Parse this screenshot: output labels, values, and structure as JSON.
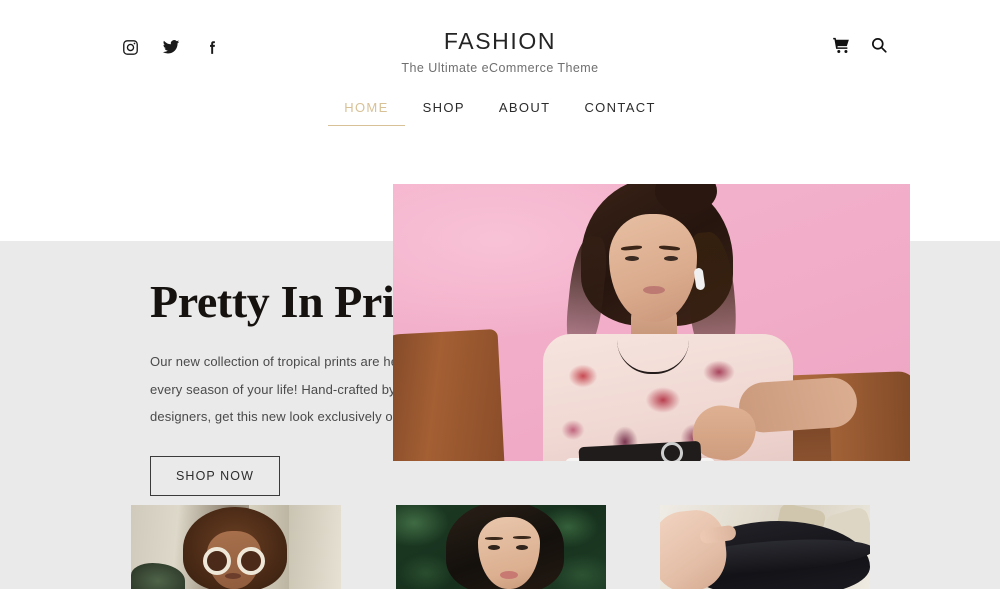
{
  "header": {
    "brand_title": "FASHION",
    "brand_tagline": "The Ultimate eCommerce Theme",
    "social": [
      {
        "name": "instagram-icon",
        "label": "Instagram"
      },
      {
        "name": "twitter-icon",
        "label": "Twitter"
      },
      {
        "name": "facebook-icon",
        "label": "Facebook"
      }
    ],
    "actions": [
      {
        "name": "cart-icon",
        "label": "Cart"
      },
      {
        "name": "search-icon",
        "label": "Search"
      }
    ]
  },
  "nav": {
    "items": [
      {
        "label": "HOME",
        "active": true
      },
      {
        "label": "SHOP",
        "active": false
      },
      {
        "label": "ABOUT",
        "active": false
      },
      {
        "label": "CONTACT",
        "active": false
      }
    ],
    "active_color": "#d8c196"
  },
  "hero": {
    "heading": "Pretty In Print",
    "paragraph": "Our new collection of tropical prints are here and ready for every season of your life! Hand-crafted by our world-class designers, get this new look exclusively online.",
    "cta_label": "SHOP NOW",
    "image_alt": "Woman in floral print blouse seated in a leather armchair against a pink backdrop",
    "background_color": "#f3b2cc"
  },
  "section": {
    "band_color": "#eaeaea",
    "page_background": "#ffffff"
  },
  "thumbnails": [
    {
      "alt": "Woman with curly hair wearing round white sunglasses"
    },
    {
      "alt": "Woman with dark hair in front of green tropical foliage"
    },
    {
      "alt": "Hand holding a black wide-brim hat"
    }
  ]
}
